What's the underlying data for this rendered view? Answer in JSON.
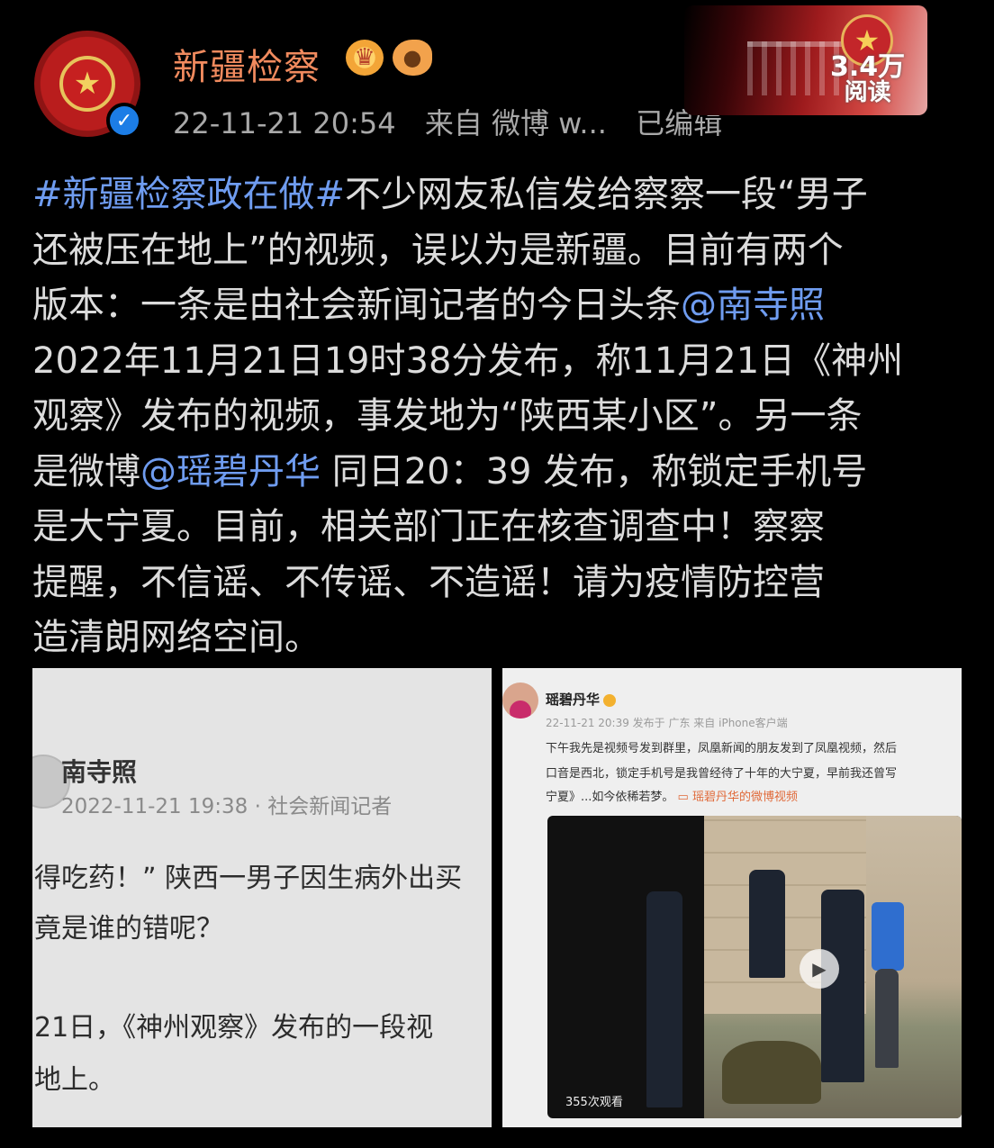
{
  "header": {
    "username": "新疆检察",
    "timestamp": "22-11-21 20:54",
    "source": "来自 微博 w...",
    "edited": "已编辑",
    "reads_count": "3.4万",
    "reads_label": "阅读"
  },
  "post": {
    "lines": [
      [
        {
          "t": "#新疆检察政在做#",
          "link": true
        },
        {
          "t": "不少网友私信发给察察一段“男子"
        }
      ],
      [
        {
          "t": "还被压在地上”的视频，误以为是新疆。目前有两个"
        }
      ],
      [
        {
          "t": "版本：一条是由社会新闻记者的今日头条"
        },
        {
          "t": "@南寺照",
          "link": true
        }
      ],
      [
        {
          "t": "2022年11月21日19时38分发布，称11月21日《神州"
        }
      ],
      [
        {
          "t": "观察》发布的视频，事发地为“陕西某小区”。另一条"
        }
      ],
      [
        {
          "t": "是微博"
        },
        {
          "t": "@瑶碧丹华",
          "link": true
        },
        {
          "t": " 同日20：39 发布，称锁定手机号"
        }
      ],
      [
        {
          "t": "是大宁夏。目前，相关部门正在核查调查中！察察"
        }
      ],
      [
        {
          "t": "提醒，不信谣、不传谣、不造谣！请为疫情防控营"
        }
      ],
      [
        {
          "t": "造清朗网络空间。"
        }
      ]
    ]
  },
  "image_left": {
    "name": "南寺照",
    "meta": "2022-11-21 19:38 · 社会新闻记者",
    "lines": [
      "得吃药！” 陕西一男子因生病外出买",
      "竟是谁的错呢？",
      "21日，《神州观察》发布的一段视",
      "地上。"
    ]
  },
  "image_right": {
    "name": "瑶碧丹华",
    "meta": "22-11-21 20:39  发布于 广东  来自 iPhone客户端",
    "lines": [
      "下午我先是视频号发到群里，凤凰新闻的朋友发到了凤凰视频，然后",
      "口音是西北，锁定手机号是我曾经待了十年的大宁夏，早前我还曾写",
      "宁夏》...如今依稀若梦。"
    ],
    "link_text": "瑶碧丹华的微博视频",
    "views": "355次观看"
  },
  "colors": {
    "username": "#f08a5e",
    "link": "#6f9cf0",
    "verified": "#1c7de6"
  },
  "icons": [
    "verified-badge-icon",
    "crown-badge-icon",
    "fish-badge-icon",
    "play-icon",
    "star-emblem-icon"
  ]
}
